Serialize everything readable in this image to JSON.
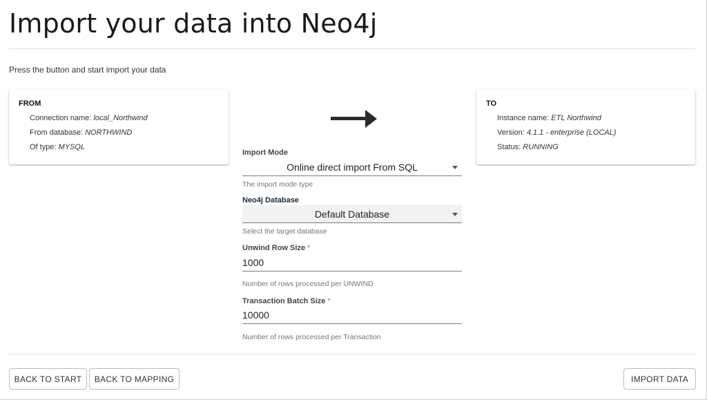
{
  "header": {
    "title": "Import your data into Neo4j",
    "subtitle": "Press the button and start import your data"
  },
  "from_card": {
    "heading": "FROM",
    "connection_label": "Connection name: ",
    "connection_value": "local_Northwind",
    "database_label": "From database: ",
    "database_value": "NORTHWIND",
    "type_label": "Of type: ",
    "type_value": "MYSQL"
  },
  "to_card": {
    "heading": "TO",
    "instance_label": "Instance name: ",
    "instance_value": "ETL Northwind",
    "version_label": "Version: ",
    "version_value": "4.1.1 - enterprise (LOCAL)",
    "status_label": "Status: ",
    "status_value": "RUNNING"
  },
  "form": {
    "import_mode": {
      "label": "Import Mode",
      "value": "Online direct import From SQL",
      "helper": "The import mode type"
    },
    "neo4j_database": {
      "label": "Neo4j Database",
      "value": "Default Database",
      "helper": "Select the target database"
    },
    "unwind_row_size": {
      "label": "Unwind Row Size",
      "required_mark": "*",
      "value": "1000",
      "helper": "Number of rows processed per UNWIND"
    },
    "transaction_batch_size": {
      "label": "Transaction Batch Size",
      "required_mark": "*",
      "value": "10000",
      "helper": "Number of rows processed per Transaction"
    }
  },
  "footer": {
    "back_to_start": "BACK TO START",
    "back_to_mapping": "BACK TO MAPPING",
    "import_data": "IMPORT DATA"
  },
  "icons": {
    "direction_arrow": "arrow-right-icon",
    "dropdown": "chevron-down-icon"
  },
  "colors": {
    "arrow": "#2b2b2b",
    "divider": "#e0e0e0",
    "select_fill": "#f2f2f2"
  }
}
